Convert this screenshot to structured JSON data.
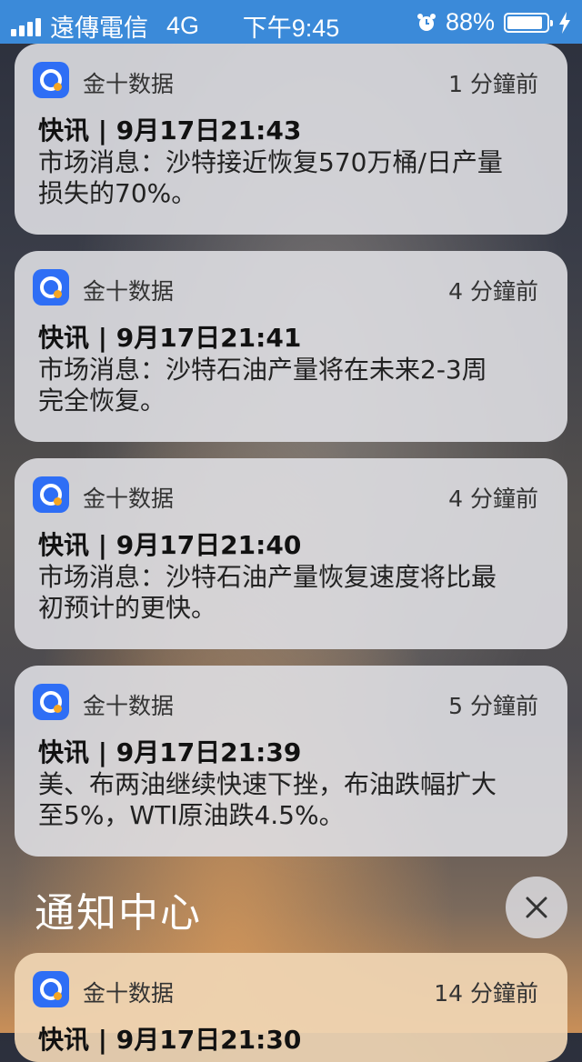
{
  "status_bar": {
    "carrier": "遠傳電信",
    "network": "4G",
    "time": "下午9:45",
    "battery": "88%",
    "battery_level": 0.88
  },
  "notification_center": {
    "title": "通知中心"
  },
  "notifications": [
    {
      "app": "金十数据",
      "time_ago": "1 分鐘前",
      "title": "快讯 | 9月17日21:43",
      "body_line1": "市场消息：沙特接近恢复570万桶/日产量",
      "body_line2": "损失的70%。"
    },
    {
      "app": "金十数据",
      "time_ago": "4 分鐘前",
      "title": "快讯 | 9月17日21:41",
      "body_line1": "市场消息：沙特石油产量将在未来2-3周",
      "body_line2": "完全恢复。"
    },
    {
      "app": "金十数据",
      "time_ago": "4 分鐘前",
      "title": "快讯 | 9月17日21:40",
      "body_line1": "市场消息：沙特石油产量恢复速度将比最",
      "body_line2": "初预计的更快。"
    },
    {
      "app": "金十数据",
      "time_ago": "5 分鐘前",
      "title": "快讯 | 9月17日21:39",
      "body_line1": "美、布两油继续快速下挫，布油跌幅扩大",
      "body_line2": "至5%，WTI原油跌4.5%。"
    },
    {
      "app": "金十数据",
      "time_ago": "14 分鐘前",
      "title": "快讯 | 9月17日21:30"
    }
  ]
}
